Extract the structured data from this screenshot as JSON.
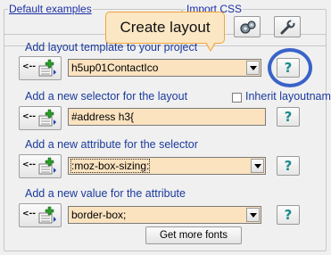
{
  "groups": {
    "default_examples": "Default examples",
    "import_css": "Import CSS"
  },
  "tooltip": {
    "text": "Create layout"
  },
  "sections": [
    {
      "label": "Add layout template to your project",
      "value": "h5up01ContactIco"
    },
    {
      "label": "Add a new selector for the layout",
      "value": "#address h3{"
    },
    {
      "label": "Add a new attribute for the selector",
      "value": ":moz-box-sizing:"
    },
    {
      "label": "Add a new value for the attribute",
      "value": "border-box;"
    }
  ],
  "inherit": {
    "label": "Inherit layoutname",
    "checked": false
  },
  "help": {
    "glyph": "?"
  },
  "more_fonts": {
    "label": "Get more fonts"
  },
  "icons": {
    "add": "add-item-icon",
    "import": "gear-icon",
    "settings": "wrench-icon"
  },
  "colors": {
    "field_bg": "#fbe3c0",
    "label_blue": "#1a3a9c",
    "tooltip_border": "#f4a53a",
    "highlight": "#3a63c8"
  }
}
